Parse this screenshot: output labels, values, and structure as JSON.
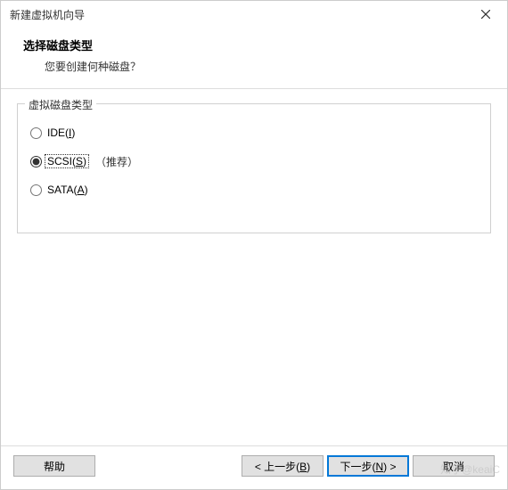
{
  "window": {
    "title": "新建虚拟机向导"
  },
  "header": {
    "title": "选择磁盘类型",
    "subtitle": "您要创建何种磁盘？"
  },
  "group": {
    "legend": "虚拟磁盘类型",
    "options": [
      {
        "prefix": "IDE(",
        "mnemonic": "I",
        "suffix": ")",
        "checked": false,
        "recommend": ""
      },
      {
        "prefix": "SCSI(",
        "mnemonic": "S",
        "suffix": ")",
        "checked": true,
        "recommend": "（推荐）"
      },
      {
        "prefix": "SATA(",
        "mnemonic": "A",
        "suffix": ")",
        "checked": false,
        "recommend": ""
      }
    ]
  },
  "buttons": {
    "help": "帮助",
    "back_prefix": "< 上一步(",
    "back_mnemonic": "B",
    "back_suffix": ")",
    "next_prefix": "下一步(",
    "next_mnemonic": "N",
    "next_suffix": ") >",
    "cancel": "取消"
  },
  "watermark": "知乎@keaiC"
}
